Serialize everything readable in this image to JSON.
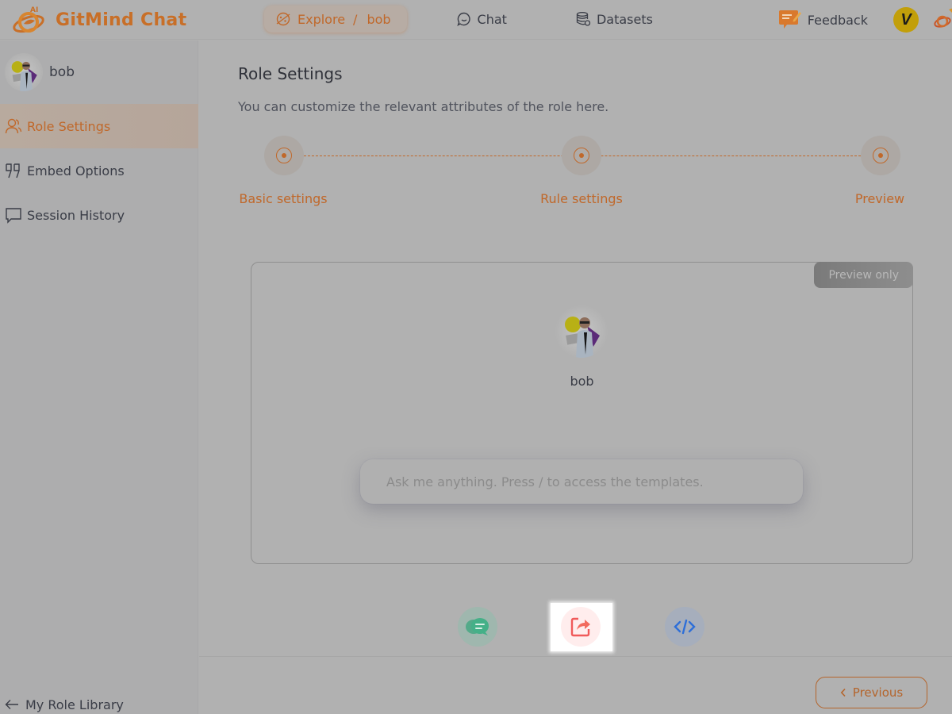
{
  "header": {
    "brand_name": "GitMind Chat",
    "brand_badge": "AI",
    "nav": {
      "explore_label": "Explore",
      "explore_separator": "/",
      "explore_current": "bob",
      "chat_label": "Chat",
      "datasets_label": "Datasets"
    },
    "feedback_label": "Feedback",
    "user_initial": "V"
  },
  "sidebar": {
    "role_name": "bob",
    "items": [
      {
        "label": "Role Settings",
        "icon": "users-icon",
        "active": true
      },
      {
        "label": "Embed Options",
        "icon": "quote-icon",
        "active": false
      },
      {
        "label": "Session History",
        "icon": "chat-bubble-icon",
        "active": false
      }
    ],
    "back_label": "My Role Library"
  },
  "main": {
    "title": "Role Settings",
    "subtitle": "You can customize the relevant attributes of the role here.",
    "steps": [
      {
        "label": "Basic settings"
      },
      {
        "label": "Rule settings"
      },
      {
        "label": "Preview"
      }
    ],
    "preview": {
      "badge": "Preview only",
      "role_name": "bob",
      "input_placeholder": "Ask me anything. Press / to access the templates."
    },
    "actions": [
      {
        "name": "chat-bubble",
        "color": "#3aa57c"
      },
      {
        "name": "share",
        "color": "#f05a5a",
        "highlighted": true
      },
      {
        "name": "embed-code",
        "color": "#2e6fd8"
      }
    ],
    "previous_label": "Previous"
  },
  "colors": {
    "accent": "#c0682a",
    "overlay_bg": "#b1b1b1"
  }
}
